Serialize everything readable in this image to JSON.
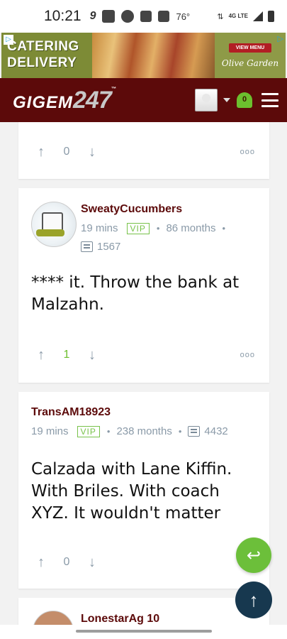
{
  "status_bar": {
    "time": "10:21",
    "temperature": "76°",
    "network": "4G LTE",
    "icons": [
      "9-icon",
      "radio-icon",
      "chat-bubble-icon",
      "facebook-icon",
      "image-icon",
      "data-arrows-icon",
      "signal-icon",
      "battery-icon"
    ]
  },
  "ad": {
    "line1": "CATERING",
    "line2": "DELIVERY",
    "cta": "VIEW MENU",
    "brand": "Olive Garden"
  },
  "header": {
    "logo_text": "GIGEM",
    "logo_num": "247",
    "logo_tm": "™",
    "notification_count": "0"
  },
  "posts": [
    {
      "votes": "0"
    },
    {
      "username": "SweatyCucumbers",
      "time": "19 mins",
      "badge": "VIP",
      "tenure": "86 months",
      "post_count": "1567",
      "body": "**** it. Throw the bank at Malzahn.",
      "votes": "1"
    },
    {
      "username": "TransAM18923",
      "time": "19 mins",
      "badge": "VIP",
      "tenure": "238 months",
      "post_count": "4432",
      "body": "Calzada with Lane Kiffin. With Briles. With coach XYZ. It wouldn't matter",
      "votes": "0"
    },
    {
      "username": "LonestarAg 10"
    }
  ],
  "more_icon": "ooo",
  "colors": {
    "header_bg": "#5c0a0a",
    "username": "#5c0a0a",
    "vip": "#78c24a",
    "reply_fab": "#6cbf3a",
    "top_fab": "#17384f"
  }
}
